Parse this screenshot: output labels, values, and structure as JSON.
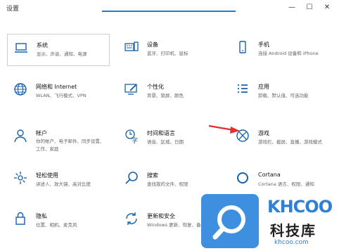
{
  "window": {
    "title": "设置",
    "minimize_icon": "—",
    "maximize_icon": "☐",
    "close_icon": "✕"
  },
  "categories": [
    {
      "name": "系统",
      "desc": "显示、声音、通知、电源",
      "icon": "laptop-icon"
    },
    {
      "name": "设备",
      "desc": "蓝牙、打印机、鼠标",
      "icon": "devices-icon"
    },
    {
      "name": "手机",
      "desc": "连接 Android 设备和 iPhone",
      "icon": "phone-icon"
    },
    {
      "name": "网络和 Internet",
      "desc": "WLAN、飞行模式、VPN",
      "icon": "globe-icon"
    },
    {
      "name": "个性化",
      "desc": "背景、锁屏、颜色",
      "icon": "personalization-icon"
    },
    {
      "name": "应用",
      "desc": "卸载、默认值、可选功能",
      "icon": "apps-icon"
    },
    {
      "name": "帐户",
      "desc": "你的帐户、电子邮件、同步设置、工作、家庭",
      "icon": "account-icon"
    },
    {
      "name": "时间和语言",
      "desc": "语音、区域、日期",
      "icon": "time-language-icon"
    },
    {
      "name": "游戏",
      "desc": "游戏栏、截屏、直播、游戏模式",
      "icon": "xbox-icon"
    },
    {
      "name": "轻松使用",
      "desc": "讲述人、放大镜、高对比度",
      "icon": "ease-of-access-icon"
    },
    {
      "name": "搜索",
      "desc": "查找我的文件、权限",
      "icon": "search-icon"
    },
    {
      "name": "Cortana",
      "desc": "Cortana 语言、权限、通知",
      "icon": "cortana-icon"
    },
    {
      "name": "隐私",
      "desc": "位置、相机、麦克风",
      "icon": "privacy-lock-icon"
    },
    {
      "name": "更新和安全",
      "desc": "Windows 更新、恢复、备份",
      "icon": "update-icon"
    }
  ],
  "annotation": {
    "color": "#e03030",
    "target": "游戏"
  },
  "watermark": {
    "logo": "KHCOO",
    "name": "科技库",
    "url": "khcoo.com"
  }
}
